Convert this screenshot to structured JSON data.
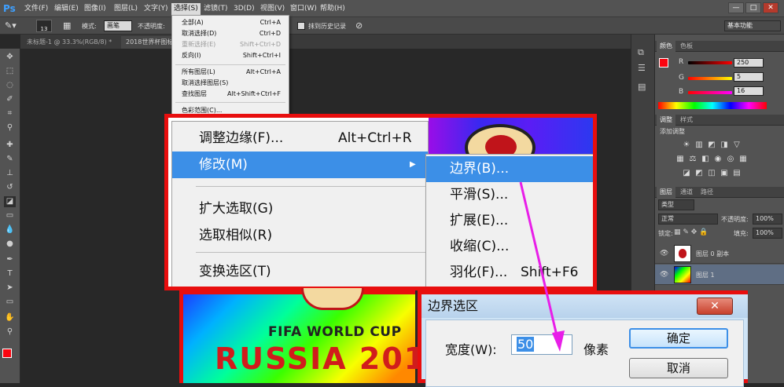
{
  "app": {
    "logo": "Ps"
  },
  "menubar": {
    "items": [
      "文件(F)",
      "编辑(E)",
      "图像(I)",
      "图层(L)",
      "文字(Y)",
      "选择(S)",
      "滤镜(T)",
      "3D(D)",
      "视图(V)",
      "窗口(W)",
      "帮助(H)"
    ],
    "active": "选择(S)",
    "window_controls": [
      "—",
      "□",
      "✕"
    ]
  },
  "options": {
    "brush_size": "13",
    "mode_label": "模式:",
    "mode_value": "画笔",
    "opacity_label": "不透明度:",
    "erase_history_label": "抹到历史记录",
    "workspace": "基本功能"
  },
  "tabs": [
    {
      "label": "未标题-1 @ 33.3%(RGB/8) *"
    },
    {
      "label": "2018世界杯图标"
    }
  ],
  "select_menu": {
    "items": [
      {
        "label": "全部(A)",
        "shortcut": "Ctrl+A",
        "disabled": false
      },
      {
        "label": "取消选择(D)",
        "shortcut": "Ctrl+D",
        "disabled": false
      },
      {
        "label": "重新选择(E)",
        "shortcut": "Shift+Ctrl+D",
        "disabled": true
      },
      {
        "label": "反向(I)",
        "shortcut": "Shift+Ctrl+I",
        "disabled": false
      },
      {
        "label": "所有图层(L)",
        "shortcut": "Alt+Ctrl+A",
        "disabled": false
      },
      {
        "label": "取消选择图层(S)",
        "shortcut": "",
        "disabled": false
      },
      {
        "label": "查找图层",
        "shortcut": "Alt+Shift+Ctrl+F",
        "disabled": false
      },
      {
        "label": "色彩范围(C)...",
        "shortcut": "",
        "disabled": false
      }
    ]
  },
  "zoomed_menu": {
    "items": [
      {
        "label": "调整边缘(F)...",
        "shortcut": "Alt+Ctrl+R"
      },
      {
        "label": "修改(M)",
        "shortcut": "",
        "submenu_arrow": "▶"
      },
      {
        "label": "扩大选取(G)",
        "shortcut": ""
      },
      {
        "label": "选取相似(R)",
        "shortcut": ""
      },
      {
        "label": "变换选区(T)",
        "shortcut": ""
      }
    ],
    "highlighted": "修改(M)"
  },
  "modify_submenu": {
    "items": [
      {
        "label": "边界(B)...",
        "shortcut": ""
      },
      {
        "label": "平滑(S)...",
        "shortcut": ""
      },
      {
        "label": "扩展(E)...",
        "shortcut": ""
      },
      {
        "label": "收缩(C)...",
        "shortcut": ""
      },
      {
        "label": "羽化(F)...",
        "shortcut": "Shift+F6"
      }
    ],
    "highlighted": "边界(B)..."
  },
  "artwork": {
    "line1": "FIFA WORLD CUP",
    "line2": "RUSSIA 201"
  },
  "border_dialog": {
    "title": "边界选区",
    "close_label": "✕",
    "width_label": "宽度(W):",
    "width_value": "50",
    "unit": "像素",
    "ok_label": "确定",
    "cancel_label": "取消"
  },
  "color_panel": {
    "tabs": [
      "颜色",
      "色板"
    ],
    "r_label": "R",
    "r_value": "250",
    "g_label": "G",
    "g_value": "5",
    "b_label": "B",
    "b_value": "16"
  },
  "adjust_panel": {
    "tabs": [
      "调整",
      "样式"
    ],
    "title": "添加调整"
  },
  "layers_panel": {
    "tabs": [
      "图层",
      "通道",
      "路径"
    ],
    "kind_label": "类型",
    "blend_mode": "正常",
    "opacity_label": "不透明度:",
    "opacity_value": "100%",
    "lock_label": "锁定:",
    "fill_label": "填充:",
    "fill_value": "100%",
    "layers": [
      {
        "name": "图层 0 副本"
      },
      {
        "name": "图层 1"
      }
    ]
  },
  "colors": {
    "accent_red": "#e80e0e",
    "highlight_blue": "#3c8fe7",
    "arrow_magenta": "#e81ee8",
    "foreground": "#fa0510"
  }
}
